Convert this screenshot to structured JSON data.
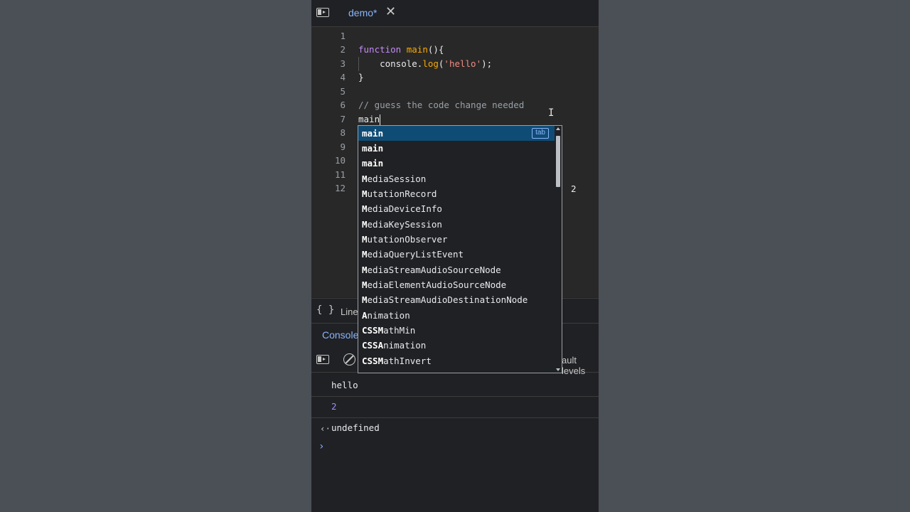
{
  "tab": {
    "title": "demo*"
  },
  "editor": {
    "line_numbers": [
      "1",
      "2",
      "3",
      "4",
      "5",
      "6",
      "7",
      "8",
      "9",
      "10",
      "11",
      "12"
    ],
    "lines": {
      "l2": {
        "kw": "function",
        "sp": " ",
        "fn": "main",
        "rest": "(){"
      },
      "l3": {
        "pre": "    console.",
        "fn": "log",
        "open": "(",
        "str": "'hello'",
        "close": ");"
      },
      "l4": "}",
      "l6": "// guess the code change needed",
      "l7": "main"
    },
    "trailing_text": "2"
  },
  "autocomplete": {
    "hint": "tab",
    "items": [
      {
        "b": "main",
        "r": ""
      },
      {
        "b": "main",
        "r": ""
      },
      {
        "b": "main",
        "r": ""
      },
      {
        "b": "M",
        "r": "ediaSession"
      },
      {
        "b": "M",
        "r": "utationRecord"
      },
      {
        "b": "M",
        "r": "ediaDeviceInfo"
      },
      {
        "b": "M",
        "r": "ediaKeySession"
      },
      {
        "b": "M",
        "r": "utationObserver"
      },
      {
        "b": "M",
        "r": "ediaQueryListEvent"
      },
      {
        "b": "M",
        "r": "ediaStreamAudioSourceNode"
      },
      {
        "b": "M",
        "r": "ediaElementAudioSourceNode"
      },
      {
        "b": "M",
        "r": "ediaStreamAudioDestinationNode"
      },
      {
        "b": "A",
        "r": "nimation"
      },
      {
        "b": "CSSM",
        "r": "athMin"
      },
      {
        "b": "CSSA",
        "r": "nimation"
      },
      {
        "b": "CSSM",
        "r": "athInvert"
      }
    ]
  },
  "status": {
    "line_info": "Line"
  },
  "console": {
    "tab_label": "Console",
    "levels_label": "ault levels",
    "output": [
      "hello",
      "2",
      "undefined"
    ]
  }
}
